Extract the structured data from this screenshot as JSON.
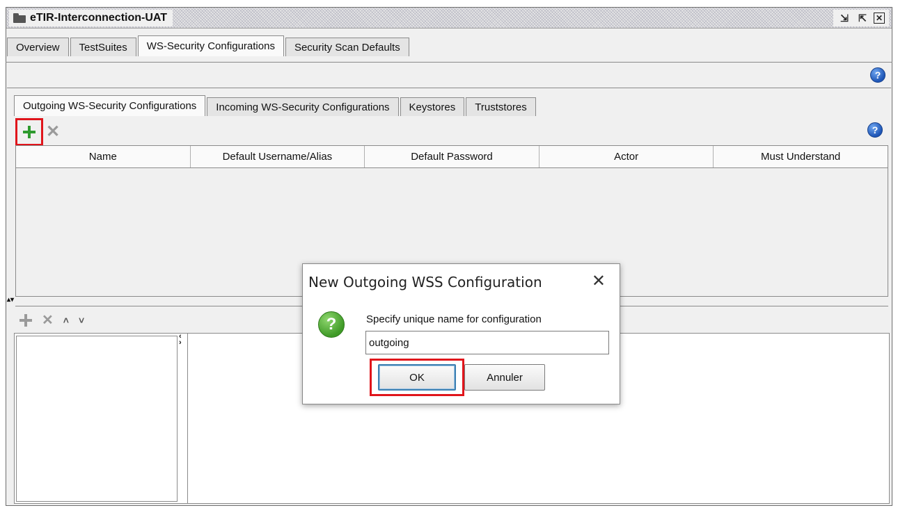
{
  "window": {
    "title": "eTIR-Interconnection-UAT"
  },
  "main_tabs": [
    {
      "label": "Overview"
    },
    {
      "label": "TestSuites"
    },
    {
      "label": "WS-Security Configurations",
      "active": true
    },
    {
      "label": "Security Scan Defaults"
    }
  ],
  "sub_tabs": [
    {
      "label": "Outgoing WS-Security Configurations",
      "active": true
    },
    {
      "label": "Incoming WS-Security Configurations"
    },
    {
      "label": "Keystores"
    },
    {
      "label": "Truststores"
    }
  ],
  "table": {
    "columns": [
      "Name",
      "Default Username/Alias",
      "Default Password",
      "Actor",
      "Must Understand"
    ],
    "rows": []
  },
  "icons": {
    "help": "?",
    "dialog_question": "?"
  },
  "dialog": {
    "title": "New Outgoing WSS Configuration",
    "prompt": "Specify unique name for configuration",
    "input_value": "outgoing",
    "ok_label": "OK",
    "cancel_label": "Annuler"
  },
  "colors": {
    "highlight": "#e0151b",
    "add_green": "#2e9a2e",
    "help_blue": "#1d55b6"
  }
}
